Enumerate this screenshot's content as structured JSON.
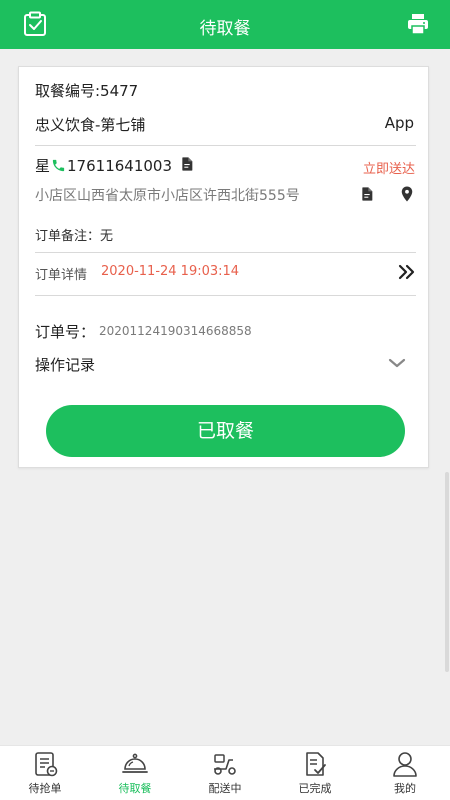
{
  "header": {
    "title": "待取餐",
    "left_icon": "clipboard-check-icon",
    "right_icon": "printer-icon"
  },
  "order": {
    "pickup_number": "取餐编号:5477",
    "shop_name": "忠义饮食-第七铺",
    "source": "App",
    "customer_name": "星",
    "phone": "17611641003",
    "deliver_status": "立即送达",
    "address": "小店区山西省太原市小店区许西北街555号",
    "note": "订单备注：无",
    "detail_label": "订单详情",
    "detail_time": "2020-11-24 19:03:14",
    "order_number_label": "订单号：",
    "order_number": "20201124190314668858",
    "operation_log": "操作记录",
    "action_button": "已取餐"
  },
  "tabs": [
    {
      "label": "待抢单",
      "icon": "order-list-icon",
      "active": false
    },
    {
      "label": "待取餐",
      "icon": "food-cloche-icon",
      "active": true
    },
    {
      "label": "配送中",
      "icon": "scooter-icon",
      "active": false
    },
    {
      "label": "已完成",
      "icon": "document-check-icon",
      "active": false
    },
    {
      "label": "我的",
      "icon": "user-icon",
      "active": false
    }
  ],
  "colors": {
    "primary": "#1dbf5e",
    "accent_red": "#e8604c"
  }
}
